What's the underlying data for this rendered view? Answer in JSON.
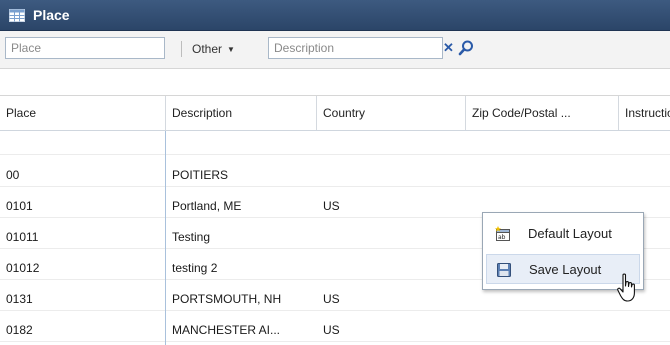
{
  "window": {
    "title": "Place",
    "icon": "table-grid-icon"
  },
  "filter": {
    "place_placeholder": "Place",
    "other_label": "Other",
    "description_placeholder": "Description",
    "clear_label": "✕",
    "icons": {
      "clear": "clear-x-icon",
      "search": "magnifier-icon"
    }
  },
  "grid": {
    "columns": [
      "Place",
      "Description",
      "Country",
      "Zip Code/Postal ...",
      "Instructions"
    ],
    "rows": [
      {
        "place": "",
        "description": "",
        "country": ""
      },
      {
        "place": "00",
        "description": "POITIERS",
        "country": ""
      },
      {
        "place": "0101",
        "description": "Portland, ME",
        "country": "US"
      },
      {
        "place": "01011",
        "description": "Testing",
        "country": ""
      },
      {
        "place": "01012",
        "description": "testing 2",
        "country": ""
      },
      {
        "place": "0131",
        "description": "PORTSMOUTH, NH",
        "country": "US"
      },
      {
        "place": "0182",
        "description": "MANCHESTER AI...",
        "country": "US"
      }
    ]
  },
  "context_menu": {
    "items": [
      {
        "label": "Default Layout",
        "icon": "default-layout-icon"
      },
      {
        "label": "Save Layout",
        "icon": "save-disk-icon"
      }
    ]
  },
  "colors": {
    "titlebar": "#2f4a6e",
    "accent": "#2a5aa8",
    "hover": "#e8eef7"
  }
}
